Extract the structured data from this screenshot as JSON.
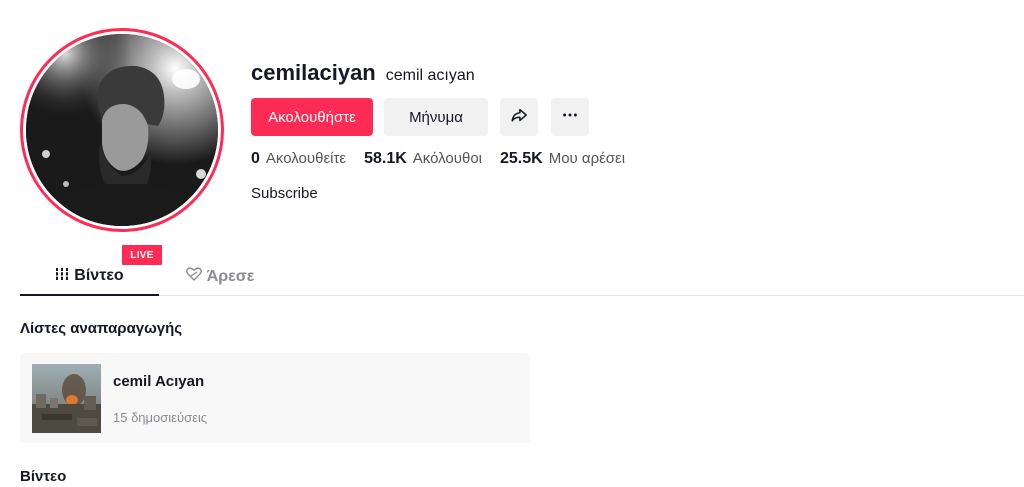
{
  "profile": {
    "username": "cemilaciyan",
    "nickname": "cemil acıyan",
    "live_badge": "LIVE",
    "bio": "Subscribe"
  },
  "actions": {
    "follow_label": "Ακολουθήστε",
    "message_label": "Μήνυμα",
    "share_icon": "share-icon",
    "more_icon": "more-icon"
  },
  "stats": [
    {
      "value": "0",
      "label": "Ακολουθείτε"
    },
    {
      "value": "58.1K",
      "label": "Ακόλουθοι"
    },
    {
      "value": "25.5K",
      "label": "Μου αρέσει"
    }
  ],
  "tabs": [
    {
      "label": "Βίντεο",
      "icon": "grid-icon",
      "active": true
    },
    {
      "label": "Άρεσε",
      "icon": "liked-heart-icon",
      "active": false
    }
  ],
  "playlists": {
    "title": "Λίστες αναπαραγωγής",
    "items": [
      {
        "name": "cemil Acıyan",
        "count": "15 δημοσιεύσεις"
      }
    ]
  },
  "videos": {
    "title": "Βίντεο"
  },
  "colors": {
    "accent": "#fe2c55",
    "text": "#161823",
    "muted": "#8a8b91",
    "button_bg": "#f1f1f2"
  }
}
